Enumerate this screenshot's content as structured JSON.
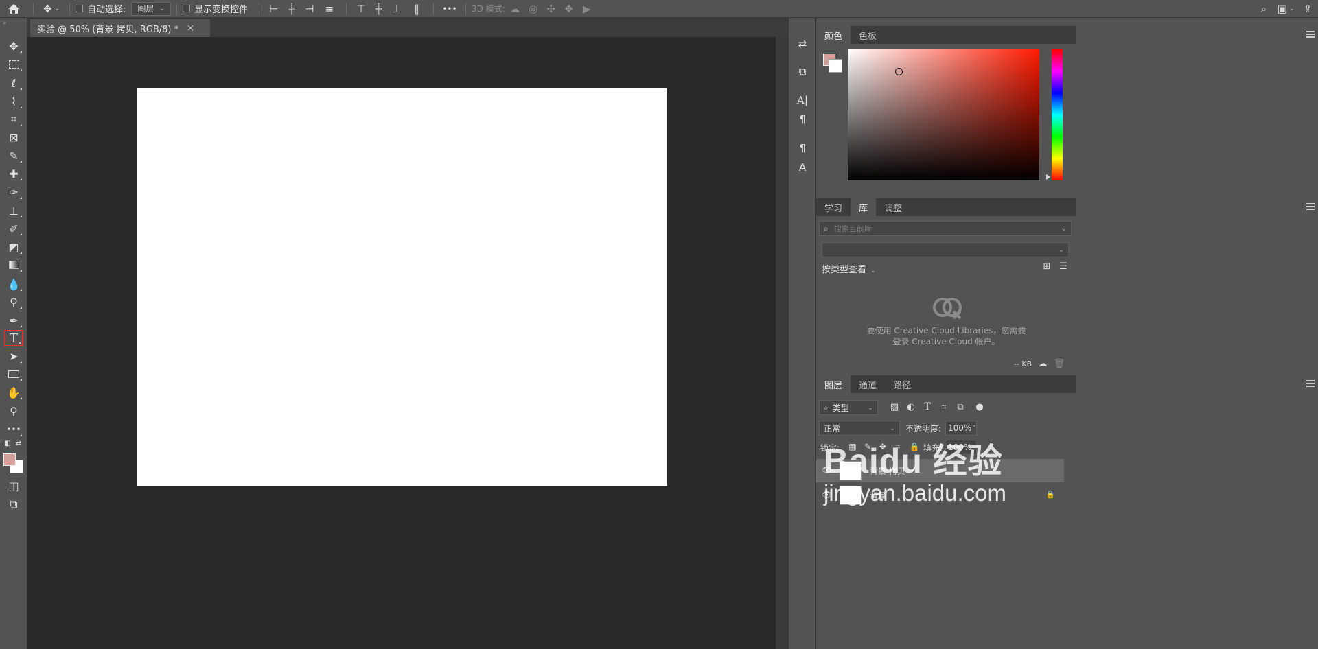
{
  "options_bar": {
    "auto_select_label": "自动选择:",
    "layer_select": "图层",
    "show_transform_label": "显示变换控件",
    "mode_3d_label": "3D 模式:",
    "more_label": "•••"
  },
  "document_tab": {
    "title": "实验 @ 50% (背景 拷贝, RGB/8) *",
    "close": "×"
  },
  "color_panel": {
    "tabs": [
      "颜色",
      "色板"
    ],
    "foreground_color": "#d3a19c",
    "background_color": "#ffffff"
  },
  "library_panel": {
    "tabs": [
      "学习",
      "库",
      "调整"
    ],
    "search_placeholder": "搜索当前库",
    "view_by_type": "按类型查看",
    "message_line1": "要使用 Creative Cloud Libraries，您需要",
    "message_line2": "登录 Creative Cloud 帐户。",
    "size_label": "-- KB"
  },
  "layers_panel": {
    "tabs": [
      "图层",
      "通道",
      "路径"
    ],
    "filter_label": "类型",
    "blend_mode": "正常",
    "opacity_label": "不透明度:",
    "opacity_value": "100%",
    "lock_label": "锁定:",
    "fill_label": "填充:",
    "fill_value": "100%",
    "layers": [
      {
        "name": "背景 拷贝"
      },
      {
        "name": "背景"
      }
    ]
  },
  "watermark": {
    "line1": "Baidu 经验",
    "line2": "jingyan.baidu.com"
  }
}
